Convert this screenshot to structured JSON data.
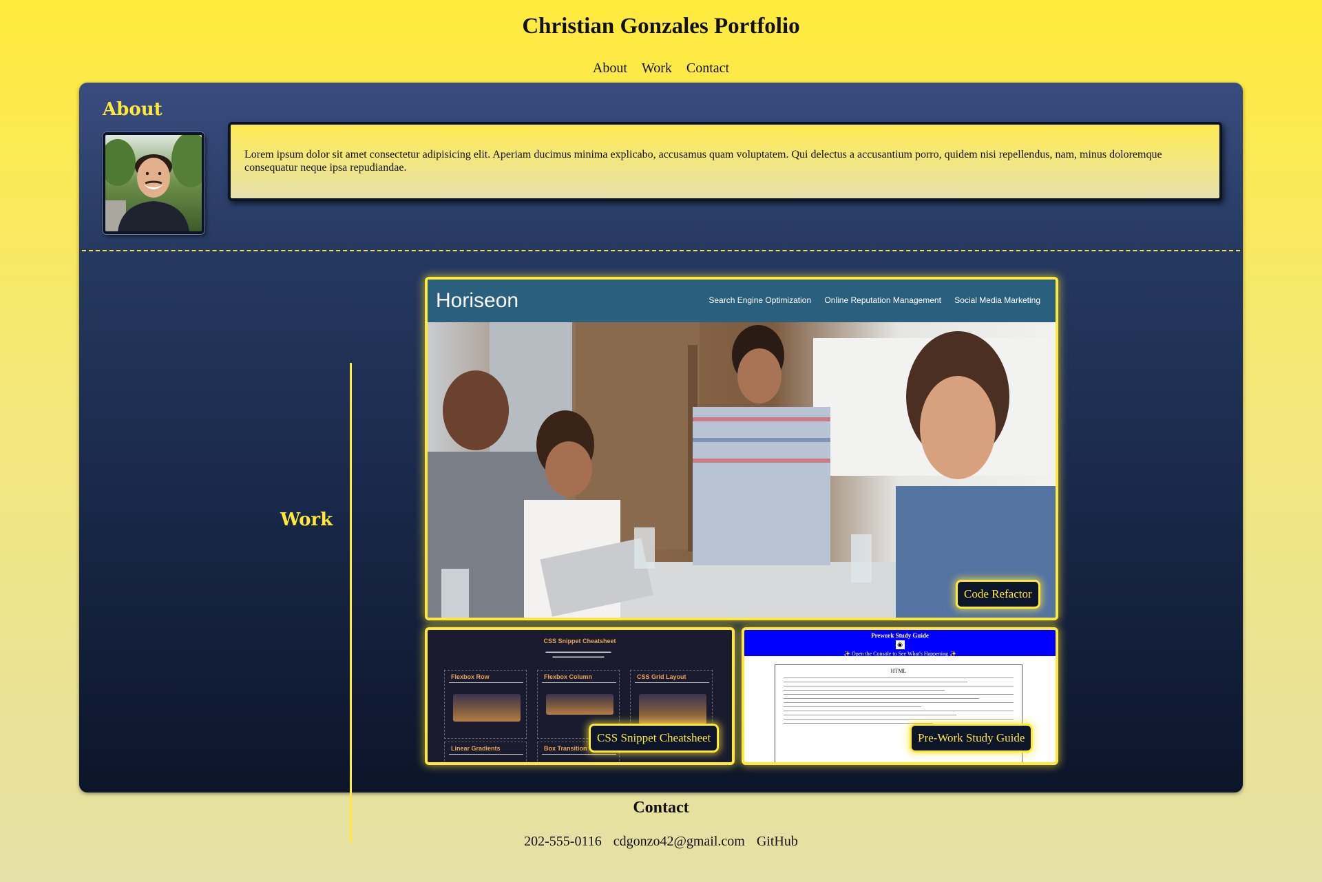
{
  "header": {
    "title": "Christian Gonzales Portfolio",
    "nav": [
      "About",
      "Work",
      "Contact"
    ]
  },
  "about": {
    "heading": "About",
    "text": "Lorem ipsum dolor sit amet consectetur adipisicing elit. Aperiam ducimus minima explicabo, accusamus quam voluptatem. Qui delectus a accusantium porro, quidem nisi repellendus, nam, minus doloremque consequatur neque ipsa repudiandae."
  },
  "work": {
    "heading": "Work",
    "projects": [
      {
        "label": "Code Refactor",
        "screenshot": {
          "logo": "Horiseon",
          "nav": [
            "Search Engine Optimization",
            "Online Reputation Management",
            "Social Media Marketing"
          ]
        }
      },
      {
        "label": "CSS Snippet Cheatsheet",
        "screenshot": {
          "title": "CSS Snippet Cheatsheet",
          "cards": [
            "Flexbox Row",
            "Flexbox Column",
            "CSS Grid Layout",
            "Linear Gradients",
            "Box Transition"
          ]
        }
      },
      {
        "label": "Pre-Work Study Guide",
        "screenshot": {
          "title": "Prework Study Guide",
          "subtitle": "✨ Open the Console to See What's Happening ✨",
          "section": "HTML"
        }
      }
    ]
  },
  "contact": {
    "heading": "Contact",
    "phone": "202-555-0116",
    "email": "cdgonzo42@gmail.com",
    "github": "GitHub"
  },
  "colors": {
    "accent": "#ffe83a",
    "panel_top": "#3a4c7e",
    "panel_bottom": "#0c1529",
    "page_top": "#ffeb3b",
    "page_bottom": "#e5e0a6"
  }
}
